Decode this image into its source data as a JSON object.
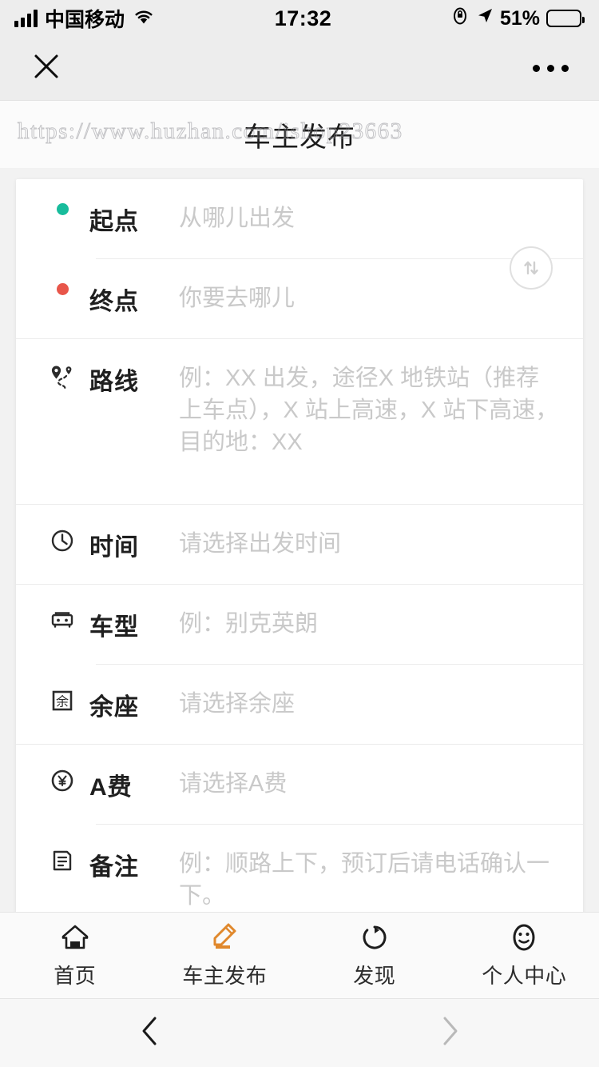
{
  "statusbar": {
    "carrier": "中国移动",
    "time": "17:32",
    "battery_pct": "51%",
    "signal_icon": "signal-bars-icon",
    "wifi_icon": "wifi-icon",
    "lock_rotation_icon": "rotation-lock-icon",
    "location_icon": "location-arrow-icon",
    "battery_icon": "battery-charging-icon"
  },
  "navbar": {
    "close_icon": "close-icon",
    "more_icon": "more-options-icon"
  },
  "header": {
    "title": "车主发布",
    "watermark": "https://www.huzhan.com/ishop23663"
  },
  "form": {
    "swap_icon": "swap-vertical-icon",
    "rows": [
      {
        "icon": "start-point-dot-icon",
        "icon_color": "#18bc9c",
        "label": "起点",
        "placeholder": "从哪儿出发"
      },
      {
        "icon": "end-point-dot-icon",
        "icon_color": "#e8564a",
        "label": "终点",
        "placeholder": "你要去哪儿"
      },
      {
        "icon": "route-pins-icon",
        "label": "路线",
        "placeholder": "例：XX 出发，途径X 地铁站（推荐上车点），X 站上高速，X 站下高速，目的地：XX"
      },
      {
        "icon": "clock-icon",
        "label": "时间",
        "placeholder": "请选择出发时间"
      },
      {
        "icon": "car-icon",
        "label": "车型",
        "placeholder": "例：别克英朗"
      },
      {
        "icon": "seat-box-icon",
        "label": "余座",
        "placeholder": "请选择余座"
      },
      {
        "icon": "yuan-circle-icon",
        "label": "A费",
        "placeholder": "请选择A费"
      },
      {
        "icon": "note-icon",
        "label": "备注",
        "placeholder": "例：顺路上下，预订后请电话确认一下。"
      }
    ]
  },
  "tabbar": {
    "active_color": "#e0882c",
    "inactive_color": "#222222",
    "items": [
      {
        "icon": "home-icon",
        "label": "首页",
        "active": false
      },
      {
        "icon": "pencil-publish-icon",
        "label": "车主发布",
        "active": true
      },
      {
        "icon": "discover-icon",
        "label": "发现",
        "active": false
      },
      {
        "icon": "profile-smiley-icon",
        "label": "个人中心",
        "active": false
      }
    ]
  },
  "browserbar": {
    "back_icon": "chevron-left-icon",
    "forward_icon": "chevron-right-icon",
    "back_enabled": true,
    "forward_enabled": false
  }
}
